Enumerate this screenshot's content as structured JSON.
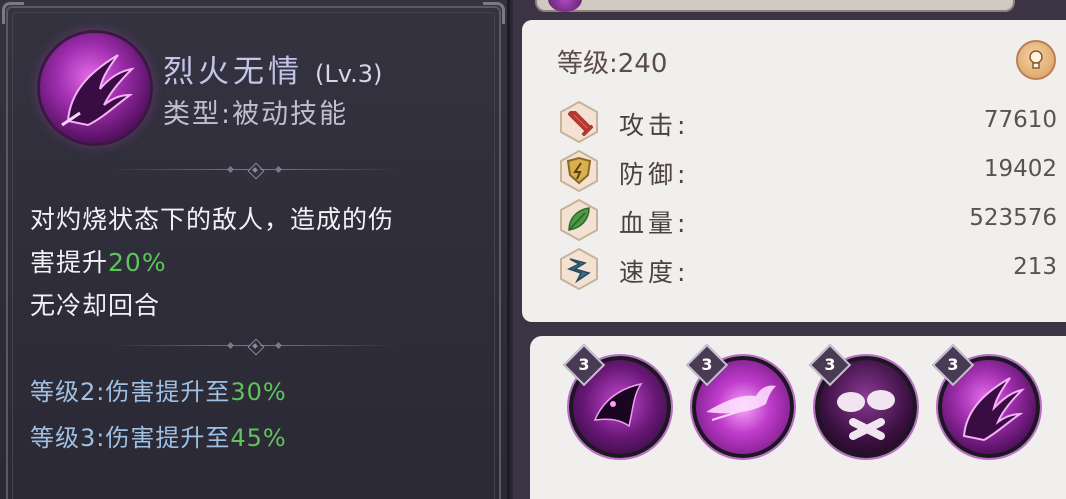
{
  "tooltip": {
    "skill_name": "烈火无情",
    "skill_level": "(Lv.3)",
    "skill_type": "类型:被动技能",
    "description_line1": "对灼烧状态下的敌人，造成的伤",
    "description_line2_prefix": "害提升",
    "description_line2_value": "20%",
    "description_line3": "无冷却回合",
    "level2_prefix": "等级2:伤害提升至",
    "level2_value": "30%",
    "level3_prefix": "等级3:伤害提升至",
    "level3_value": "45%"
  },
  "stats": {
    "grade": "等级:240",
    "rows": [
      {
        "label": "攻击:",
        "value": "77610",
        "icon": "sword-icon"
      },
      {
        "label": "防御:",
        "value": "19402",
        "icon": "shield-icon"
      },
      {
        "label": "血量:",
        "value": "523576",
        "icon": "leaf-icon"
      },
      {
        "label": "速度:",
        "value": "213",
        "icon": "wind-icon"
      }
    ]
  },
  "skills": [
    {
      "icon": "crow-skill-icon",
      "level": "3"
    },
    {
      "icon": "phoenix-skill-icon",
      "level": "3"
    },
    {
      "icon": "skull-skill-icon",
      "level": "3"
    },
    {
      "icon": "wing-skill-icon",
      "level": "3"
    }
  ],
  "colors": {
    "accent_green": "#5fc45a",
    "level_blue": "#9fc0e3",
    "skill_purple": "#b04ac0"
  }
}
